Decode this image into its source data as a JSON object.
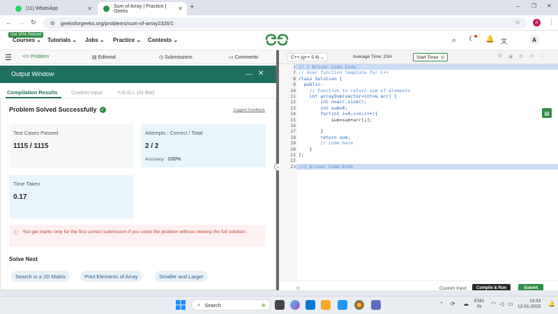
{
  "browser": {
    "tabs": [
      {
        "label": "(11) WhatsApp"
      },
      {
        "label": "Sum of Array | Practice | Geeks"
      }
    ],
    "url": "geeksforgeeks.org/problems/sum-of-array2326/1",
    "profile_initial": "A"
  },
  "header": {
    "offer_badge": "Get 90% Refund",
    "menu": [
      "Courses",
      "Tutorials",
      "Jobs",
      "Practice",
      "Contests"
    ],
    "logo": "GG",
    "avatar": "A"
  },
  "problem_tabs": [
    "Problem",
    "Editorial",
    "Submissions",
    "Comments"
  ],
  "output": {
    "title": "Output Window",
    "minimize": "__",
    "close": "✕",
    "tabs": [
      "Compilation Results",
      "Custom Input",
      "Y.O.G.I. (AI Bot)"
    ],
    "status": "Problem Solved Successfully",
    "suggest": "Suggest Feedback",
    "cards": {
      "tests_label": "Test Cases Passed",
      "tests_value": "1115 / 1115",
      "attempts_label": "Attempts : Correct / Total",
      "attempts_value": "2 / 2",
      "accuracy_label": "Accuracy :",
      "accuracy_value": "100%",
      "time_label": "Time Taken",
      "time_value": "0.17"
    },
    "warning": "You get marks only for the first correct submission if you solve the problem without viewing the full solution.",
    "solve_next_title": "Solve Next",
    "solve_next": [
      "Search in a 2D Matrix",
      "Print Elements of Array",
      "Smaller and Larger"
    ]
  },
  "editor": {
    "language": "C++ (g++ 5.4)",
    "average_time": "Average Time: 20m",
    "timer_label": "Start Timer",
    "line_numbers": [
      "1",
      "7",
      "8",
      "9",
      "10",
      "11",
      "12",
      "13",
      "14",
      "15",
      "16",
      "17",
      "18",
      "19",
      "20",
      "21",
      "22",
      "23"
    ],
    "lines": [
      "// } Driver Code Ends",
      "// User function template for C++",
      "class Solution {",
      "  public:",
      "    // Function to return sum of elements",
      "    int arraySum(vector<int>& arr) {",
      "        int n=arr.size();",
      "        int sum=0;",
      "        for(int i=0;i<n;i++){",
      "            sum=sum+arr[i];",
      "",
      "        }",
      "        return sum;",
      "        // code here",
      "    }",
      "};",
      "",
      "//{ Driver Code Ends"
    ],
    "custom_input": "Custom Input",
    "compile_run": "Compile & Run",
    "submit": "Submit"
  },
  "taskbar": {
    "search": "Search",
    "lang_top": "ENG",
    "lang_bottom": "IN",
    "time": "19:33",
    "date": "12-01-2025"
  },
  "colors": {
    "gfg_green": "#2f8d46",
    "output_header": "#1f6f5f",
    "highlight": "#c9dcf5"
  }
}
